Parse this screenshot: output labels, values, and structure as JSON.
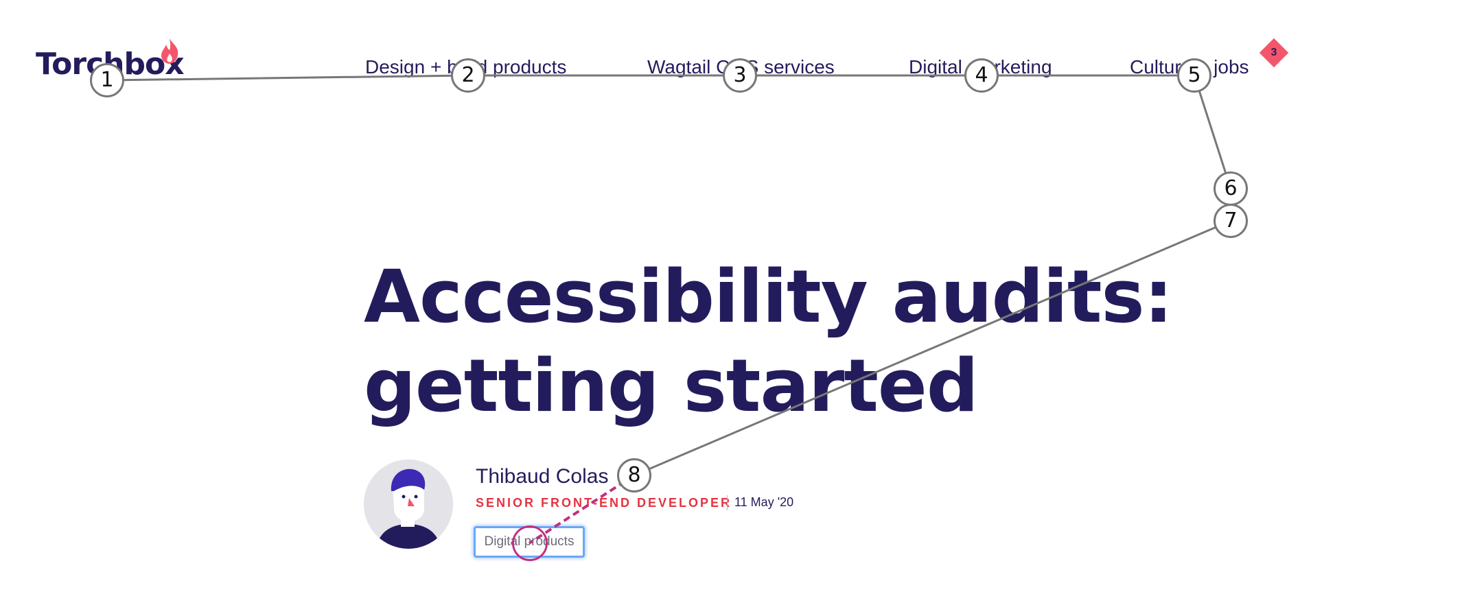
{
  "header": {
    "logo_text": "Torchbox",
    "nav": [
      {
        "label": "Design + build products"
      },
      {
        "label": "Wagtail CMS services"
      },
      {
        "label": "Digital marketing"
      },
      {
        "label": "Culture + jobs"
      }
    ],
    "jobs_badge": "3"
  },
  "article": {
    "title_line1": "Accessibility audits:",
    "title_line2": "getting started",
    "author_name": "Thibaud Colas",
    "author_role": "SENIOR FRONT-END DEVELOPER",
    "date": "11 May '20",
    "tag": "Digital products"
  },
  "overlay": {
    "markers": [
      "1",
      "2",
      "3",
      "4",
      "5",
      "6",
      "7",
      "8"
    ],
    "path_color": "#777777",
    "click_color": "#c0307f"
  },
  "colors": {
    "brand": "#231c5c",
    "accent_red": "#e53340",
    "flame": "#f3566b",
    "focus": "#6aa7f8"
  }
}
